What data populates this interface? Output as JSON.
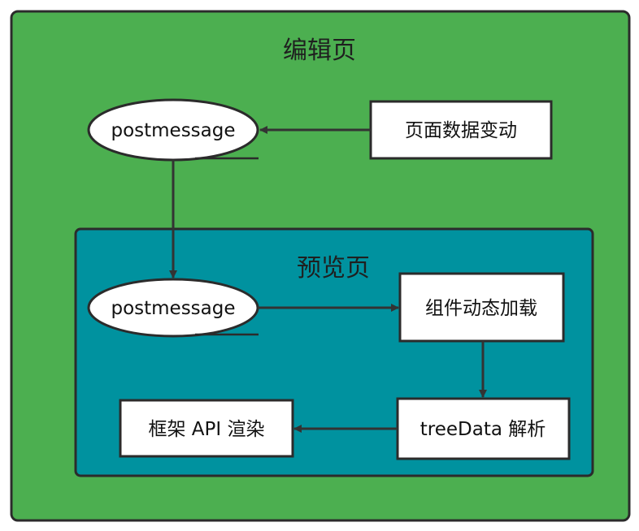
{
  "editor_page": {
    "title": "编辑页",
    "fill": "#4caf50"
  },
  "preview_page": {
    "title": "预览页",
    "fill": "#00929f"
  },
  "nodes": {
    "editor_postmessage": "postmessage",
    "page_data_change": "页面数据变动",
    "preview_postmessage": "postmessage",
    "component_dynamic_load": "组件动态加载",
    "treedata_parse": "treeData 解析",
    "framework_api_render": "框架 API 渲染"
  }
}
